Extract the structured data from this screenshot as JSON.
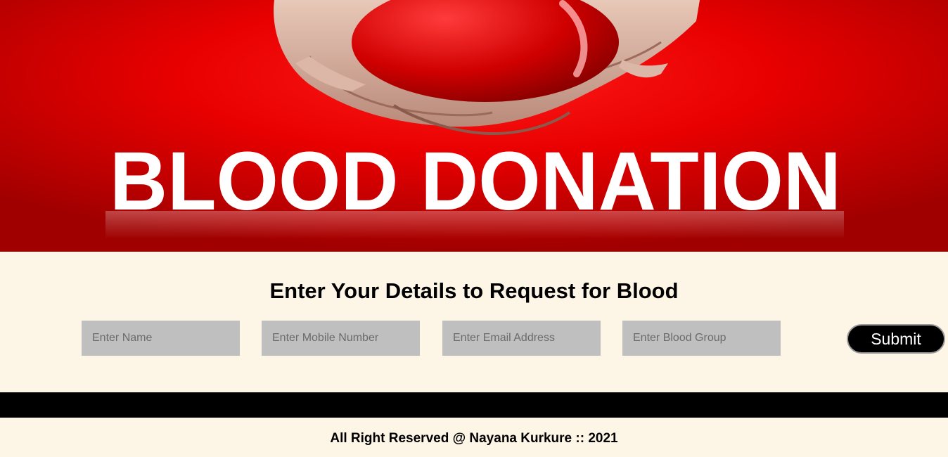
{
  "banner": {
    "title": "BLOOD DONATION"
  },
  "form": {
    "heading": "Enter Your Details to Request for Blood",
    "fields": [
      {
        "placeholder": "Enter Name"
      },
      {
        "placeholder": "Enter Mobile Number"
      },
      {
        "placeholder": "Enter Email Address"
      },
      {
        "placeholder": "Enter Blood Group"
      }
    ],
    "submit_label": "Submit"
  },
  "footer": {
    "text": "All Right Reserved @ Nayana Kurkure :: 2021"
  },
  "colors": {
    "banner_red": "#e00000",
    "page_background": "#fdf5e6",
    "field_background": "#bfbfbf",
    "button_background": "#000000"
  }
}
